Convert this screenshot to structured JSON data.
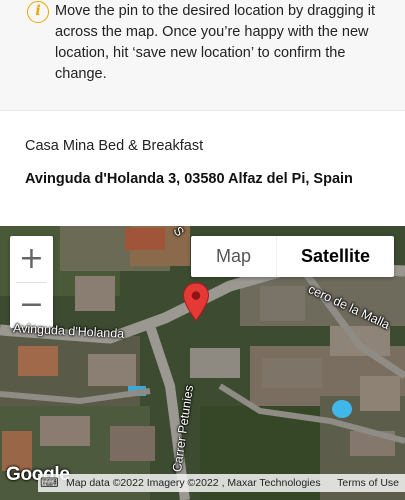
{
  "info": {
    "icon": "info-icon",
    "icon_glyph": "i",
    "accent_color": "#e5a800",
    "text": "Move the pin to the desired location by dragging it across the map. Once you’re happy with the new location, hit ‘save new location’ to confirm the change."
  },
  "property": {
    "name": "Casa Mina Bed & Breakfast",
    "address": "Avinguda d'Holanda 3, 03580 Alfaz del Pi, Spain"
  },
  "map": {
    "zoom_in_label": "+",
    "zoom_out_label": "−",
    "type_map_label": "Map",
    "type_satellite_label": "Satellite",
    "selected_type": "Satellite",
    "road_labels": {
      "avinguda": "Avinguda d'Holanda",
      "carrer": "Carrer Petunies",
      "malla": "cero de la Malla",
      "top_s": "S"
    },
    "google_logo": "Google",
    "keyboard_icon": "keyboard-icon",
    "attribution": "Map data ©2022 Imagery ©2022 , Maxar Technologies",
    "terms": "Terms of Use",
    "pin_color": "#e53935"
  }
}
